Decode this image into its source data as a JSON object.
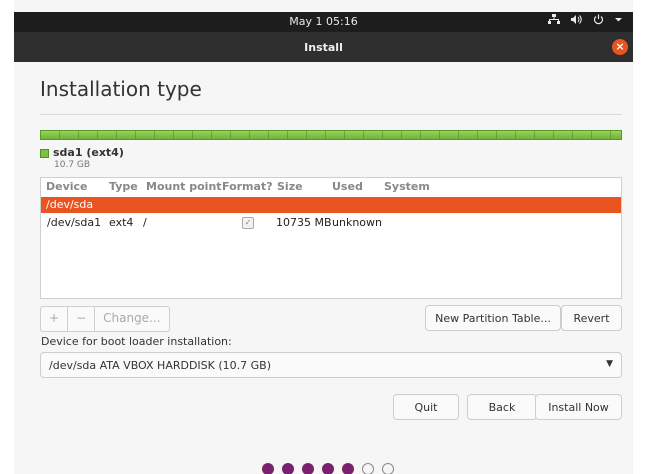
{
  "topbar": {
    "clock": "May 1  05:16",
    "tray": [
      "network-icon",
      "volume-icon",
      "power-icon",
      "chevron-down-icon"
    ]
  },
  "window": {
    "title": "Install",
    "close_label": "×"
  },
  "page": {
    "heading": "Installation type"
  },
  "partition_bar": {
    "color": "#7bc142",
    "legend_label": "sda1 (ext4)",
    "legend_size": "10.7 GB"
  },
  "table": {
    "columns": [
      "Device",
      "Type",
      "Mount point",
      "Format?",
      "Size",
      "Used",
      "System"
    ],
    "selected_row": "/dev/sda",
    "rows": [
      {
        "device": "/dev/sda1",
        "type": "ext4",
        "mount": "/",
        "format": true,
        "size": "10735 MB",
        "used": "unknown",
        "system": ""
      }
    ]
  },
  "toolbar": {
    "add": "+",
    "remove": "−",
    "change": "Change..."
  },
  "buttons": {
    "new_table": "New Partition Table...",
    "revert": "Revert",
    "quit": "Quit",
    "back": "Back",
    "install_now": "Install Now"
  },
  "boot_loader": {
    "label": "Device for boot loader installation:",
    "selected": "/dev/sda   ATA VBOX HARDDISK (10.7 GB)"
  },
  "progress": {
    "filled_steps": 5,
    "total_steps": 7
  },
  "colors": {
    "accent": "#e95420",
    "progress": "#77216f"
  }
}
